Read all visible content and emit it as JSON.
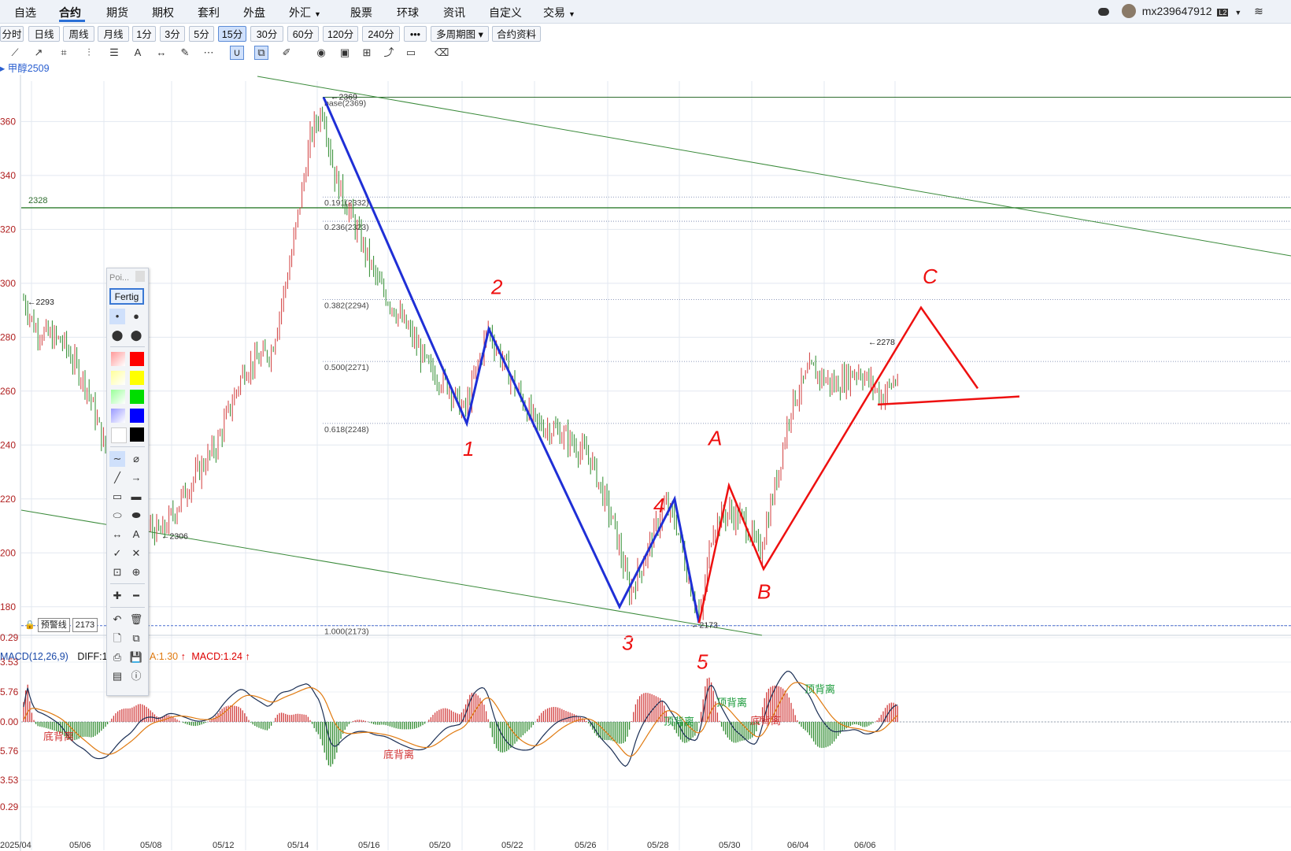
{
  "menu": {
    "items": [
      "自选",
      "合约",
      "期货",
      "期权",
      "套利",
      "外盘",
      "外汇",
      "股票",
      "环球",
      "资讯",
      "自定义",
      "交易"
    ],
    "active": "合约",
    "user": "mx239647912",
    "badge": "L2"
  },
  "periods": [
    "分时",
    "日线",
    "周线",
    "月线",
    "1分",
    "3分",
    "5分",
    "15分",
    "30分",
    "60分",
    "120分",
    "240分",
    "•••",
    "多周期图",
    "合约资料"
  ],
  "active_period": "15分",
  "symbol": "甲醇2509",
  "palette": {
    "title": "Poi...",
    "done": "Fertig",
    "colors": [
      "#ff9999",
      "#ff0000",
      "#ffff99",
      "#ffff00",
      "#99ff99",
      "#00dd00",
      "#9999ff",
      "#0000ff",
      "#ffffff",
      "#000000"
    ]
  },
  "alert": {
    "label": "预警线",
    "value": "2173"
  },
  "chart_data": {
    "type": "candlestick",
    "price_axis": {
      "ticks_shown": [
        "360",
        "340",
        "320",
        "300",
        "280",
        "260",
        "240",
        "220",
        "200",
        "180"
      ],
      "range": [
        2170,
        2375
      ]
    },
    "date_labels": [
      "2025/04",
      "05/06",
      "05/08",
      "05/12",
      "05/14",
      "05/16",
      "05/20",
      "05/22",
      "05/26",
      "05/28",
      "05/30",
      "06/04",
      "06/06"
    ],
    "price_labels": [
      {
        "text": "2369",
        "value": 2369
      },
      {
        "text": "2293",
        "value": 2293
      },
      {
        "text": "2306",
        "value": 2206
      },
      {
        "text": "2173",
        "value": 2173
      },
      {
        "text": "2278",
        "value": 2278
      },
      {
        "text": "2328",
        "value": 2328
      }
    ],
    "fibonacci": [
      {
        "label": "base(2369)",
        "value": 2369
      },
      {
        "label": "0.191(2332)",
        "value": 2332
      },
      {
        "label": "0.236(2323)",
        "value": 2323
      },
      {
        "label": "0.382(2294)",
        "value": 2294
      },
      {
        "label": "0.500(2271)",
        "value": 2271
      },
      {
        "label": "0.618(2248)",
        "value": 2248
      },
      {
        "label": "1.000(2173)",
        "value": 2173
      }
    ],
    "hline": {
      "label": "2328",
      "value": 2328
    },
    "elliott_labels": [
      "1",
      "2",
      "3",
      "4",
      "5",
      "A",
      "B",
      "C"
    ],
    "macd": {
      "title": "MACD(12,26,9)",
      "diff_label": "DIFF:1.",
      "dea_label": "A:1.30",
      "macd_label": "MACD:1.24",
      "ticks": [
        "0.29",
        "3.53",
        "5.76",
        "0.00",
        "5.76",
        "3.53",
        "0.29"
      ],
      "divergence_labels": [
        "底背离",
        "底背离",
        "顶背离",
        "顶背离",
        "底背离",
        "顶背离"
      ]
    }
  }
}
